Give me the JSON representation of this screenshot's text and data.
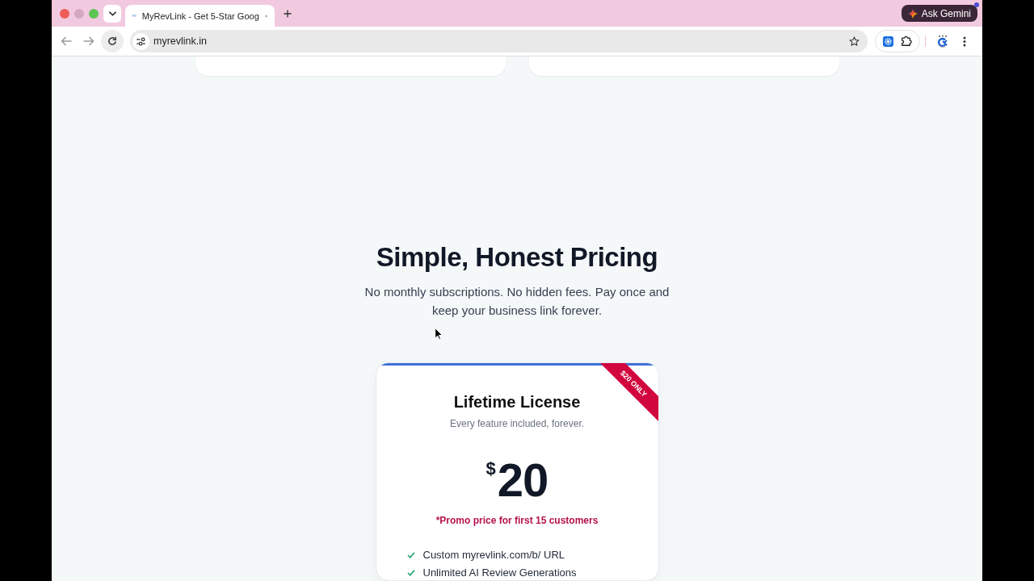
{
  "browser": {
    "tabs": [
      {
        "title": "MyRevLink - Get 5-Star Goog",
        "selected": true
      }
    ],
    "assistant_button": "Ask Gemini",
    "address": "myrevlink.in"
  },
  "pricing": {
    "title": "Simple, Honest Pricing",
    "subtitle": "No monthly subscriptions. No hidden fees. Pay once and keep your business link forever.",
    "plans": [
      {
        "name": "Lifetime License",
        "tagline": "Every feature included, forever.",
        "ribbon": "$20 ONLY",
        "currency": "$",
        "amount": "20",
        "promo": "*Promo price for first 15 customers",
        "features": [
          "Custom myrevlink.com/b/ URL",
          "Unlimited AI Review Generations"
        ]
      }
    ]
  }
}
